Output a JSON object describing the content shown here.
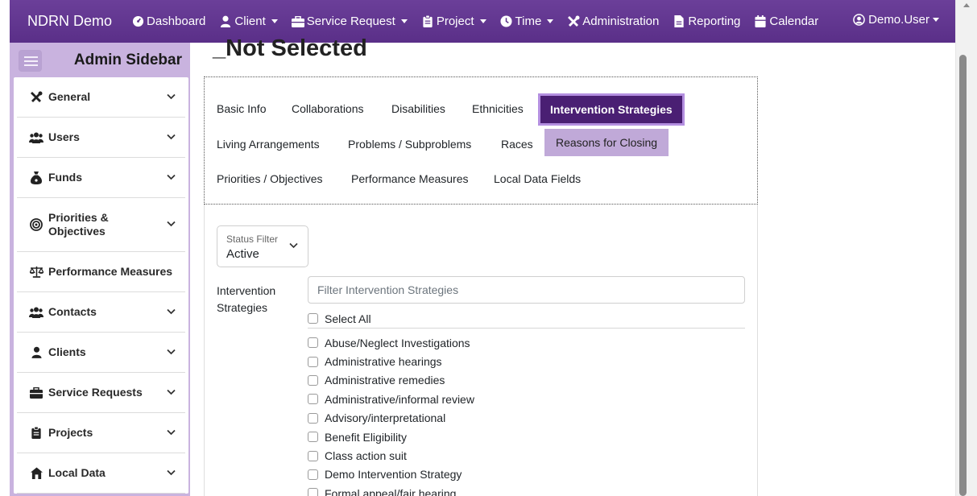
{
  "navbar": {
    "brand": "NDRN Demo",
    "items": [
      {
        "label": "Dashboard",
        "icon": "dashboard-icon",
        "dropdown": false
      },
      {
        "label": "Client",
        "icon": "user-icon",
        "dropdown": true
      },
      {
        "label": "Service Request",
        "icon": "briefcase-icon",
        "dropdown": true
      },
      {
        "label": "Project",
        "icon": "clipboard-icon",
        "dropdown": true
      },
      {
        "label": "Time",
        "icon": "clock-icon",
        "dropdown": true
      },
      {
        "label": "Administration",
        "icon": "tools-icon",
        "dropdown": false
      },
      {
        "label": "Reporting",
        "icon": "file-icon",
        "dropdown": false
      },
      {
        "label": "Calendar",
        "icon": "calendar-icon",
        "dropdown": false
      }
    ],
    "user": "Demo.User"
  },
  "sidebar": {
    "title": "Admin Sidebar",
    "items": [
      {
        "label": "General",
        "icon": "tools-icon",
        "expandable": true
      },
      {
        "label": "Users",
        "icon": "users-icon",
        "expandable": true
      },
      {
        "label": "Funds",
        "icon": "money-bag-icon",
        "expandable": true
      },
      {
        "label": "Priorities & Objectives",
        "icon": "target-icon",
        "expandable": true
      },
      {
        "label": "Performance Measures",
        "icon": "scale-icon",
        "expandable": false
      },
      {
        "label": "Contacts",
        "icon": "users-icon",
        "expandable": true
      },
      {
        "label": "Clients",
        "icon": "user-icon",
        "expandable": true
      },
      {
        "label": "Service Requests",
        "icon": "briefcase-icon",
        "expandable": true
      },
      {
        "label": "Projects",
        "icon": "clipboard-icon",
        "expandable": true
      },
      {
        "label": "Local Data",
        "icon": "house-icon",
        "expandable": true
      }
    ]
  },
  "page": {
    "title": "_Not Selected"
  },
  "tabs": [
    {
      "label": "Basic Info",
      "state": "normal"
    },
    {
      "label": "Collaborations",
      "state": "normal"
    },
    {
      "label": "Disabilities",
      "state": "normal"
    },
    {
      "label": "Ethnicities",
      "state": "normal"
    },
    {
      "label": "Intervention Strategies",
      "state": "active"
    },
    {
      "label": "Living Arrangements",
      "state": "normal"
    },
    {
      "label": "Problems / Subproblems",
      "state": "normal"
    },
    {
      "label": "Races",
      "state": "normal"
    },
    {
      "label": "Reasons for Closing",
      "state": "hover"
    },
    {
      "label": "Priorities / Objectives",
      "state": "normal"
    },
    {
      "label": "Performance Measures",
      "state": "normal"
    },
    {
      "label": "Local Data Fields",
      "state": "normal"
    }
  ],
  "status_filter": {
    "label": "Status Filter",
    "value": "Active"
  },
  "strategies": {
    "label": "Intervention Strategies",
    "placeholder": "Filter Intervention Strategies",
    "select_all": "Select All",
    "options": [
      "Abuse/Neglect Investigations",
      "Administrative hearings",
      "Administrative remedies",
      "Administrative/informal review",
      "Advisory/interpretational",
      "Benefit Eligibility",
      "Class action suit",
      "Demo Intervention Strategy",
      "Formal appeal/fair hearing"
    ]
  },
  "colors": {
    "navbar": "#5a2f88",
    "sidebar": "#c9b3df",
    "active_tab": "#4a1f73",
    "hover_tab": "#c0a9d8"
  }
}
